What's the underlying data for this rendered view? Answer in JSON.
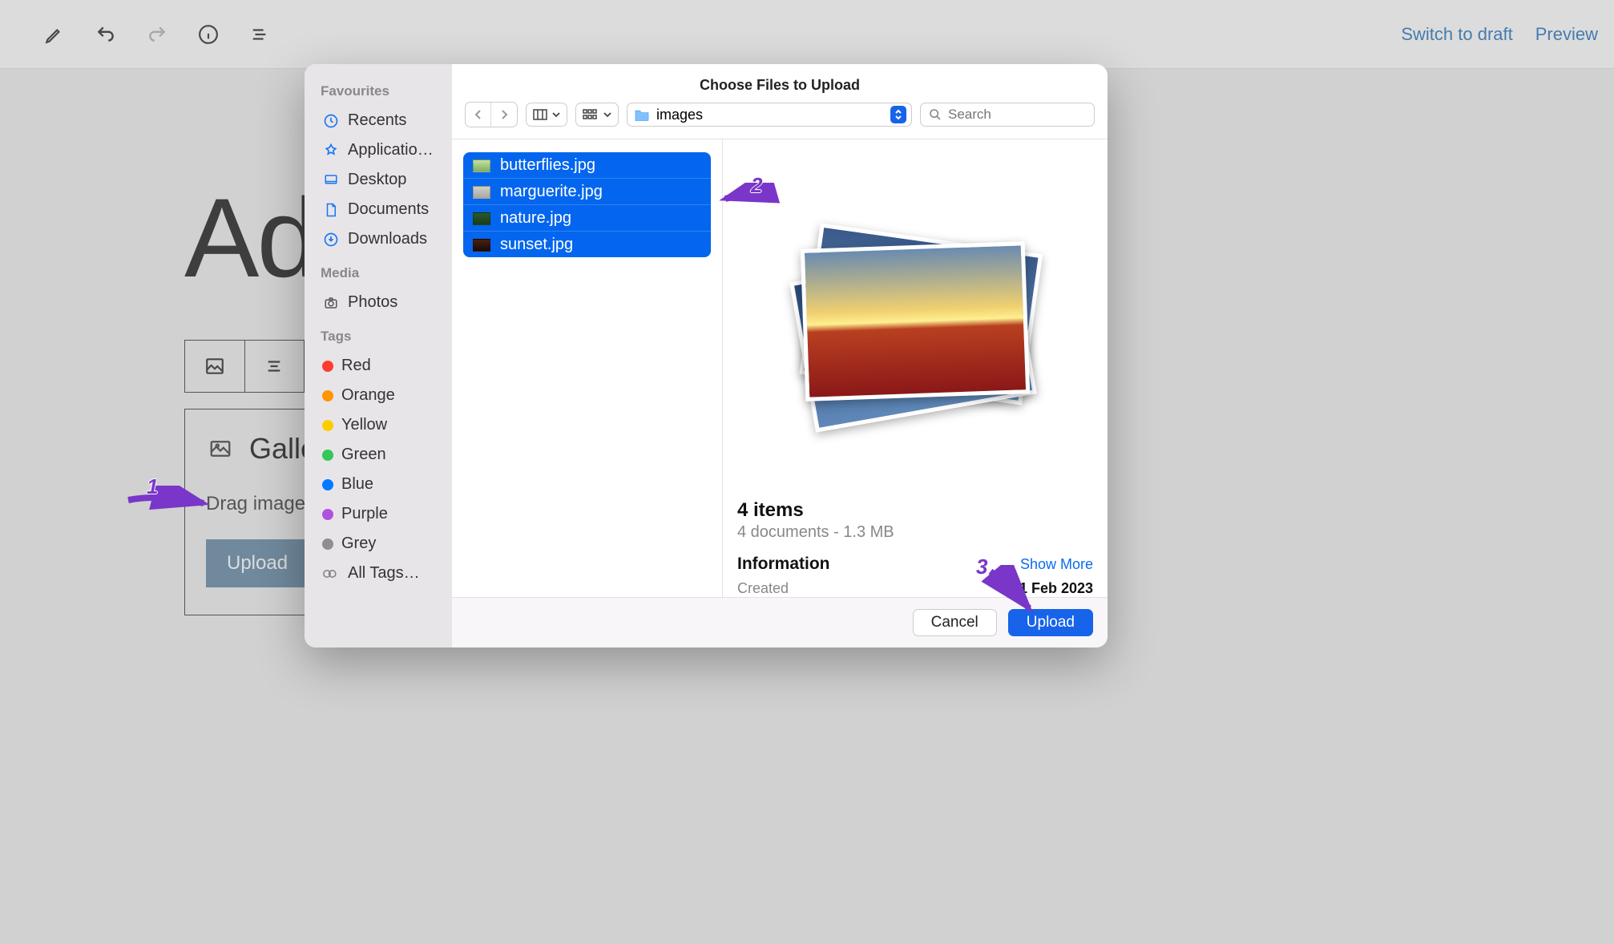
{
  "topbar": {
    "switch_to_draft": "Switch to draft",
    "preview": "Preview"
  },
  "editor": {
    "title_fragment": "Ad",
    "gallery_label": "Galle",
    "drag_hint": "Drag images,",
    "upload_button": "Upload"
  },
  "annotations": {
    "one": "1",
    "two": "2",
    "three": "3"
  },
  "filepicker": {
    "title": "Choose Files to Upload",
    "sidebar": {
      "favourites_label": "Favourites",
      "favourites": [
        "Recents",
        "Applicatio…",
        "Desktop",
        "Documents",
        "Downloads"
      ],
      "media_label": "Media",
      "media": [
        "Photos"
      ],
      "tags_label": "Tags",
      "tags": [
        {
          "label": "Red",
          "color": "#ff3b30"
        },
        {
          "label": "Orange",
          "color": "#ff9500"
        },
        {
          "label": "Yellow",
          "color": "#ffcc00"
        },
        {
          "label": "Green",
          "color": "#34c759"
        },
        {
          "label": "Blue",
          "color": "#007aff"
        },
        {
          "label": "Purple",
          "color": "#af52de"
        },
        {
          "label": "Grey",
          "color": "#8e8e93"
        }
      ],
      "all_tags": "All Tags…"
    },
    "folder": "images",
    "search_placeholder": "Search",
    "files": [
      "butterflies.jpg",
      "marguerite.jpg",
      "nature.jpg",
      "sunset.jpg"
    ],
    "preview": {
      "count_line": "4 items",
      "detail_line": "4 documents - 1.3 MB",
      "information_label": "Information",
      "show_more": "Show More",
      "created_label": "Created",
      "created_value": "1 Feb 2023"
    },
    "footer": {
      "cancel": "Cancel",
      "upload": "Upload"
    }
  }
}
